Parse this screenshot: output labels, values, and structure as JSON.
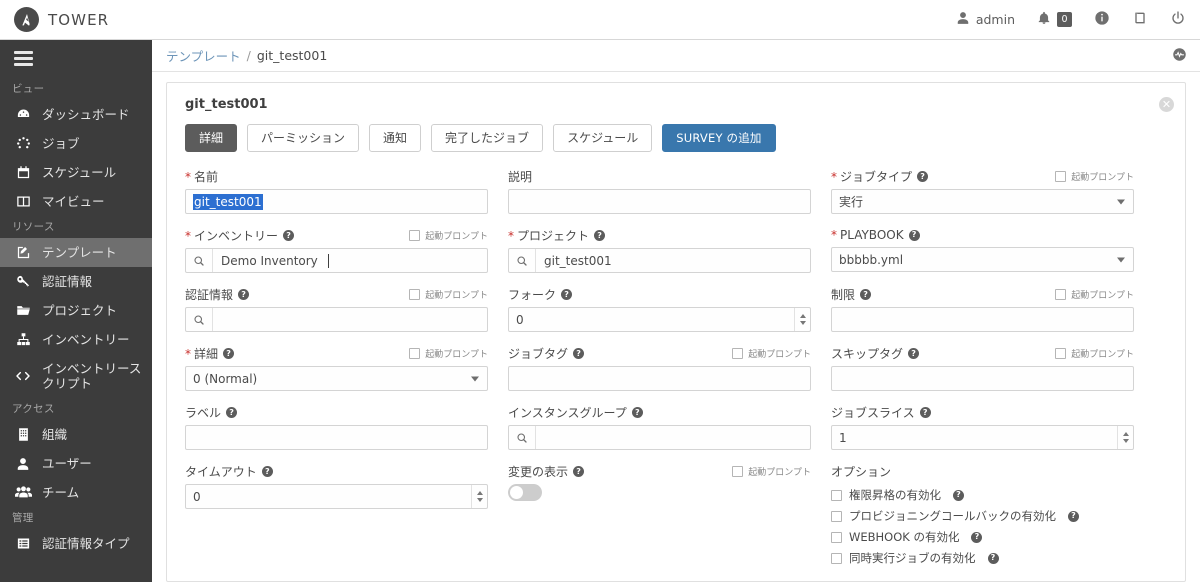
{
  "topbar": {
    "brand": "TOWER",
    "user": "admin",
    "notification_count": "0",
    "icons": [
      "user-icon",
      "bell-icon",
      "info-icon",
      "book-icon",
      "power-icon"
    ]
  },
  "sidebar": {
    "sections": [
      {
        "title": "ビュー",
        "items": [
          {
            "label": "ダッシュボード",
            "icon": "dashboard-icon",
            "active": false
          },
          {
            "label": "ジョブ",
            "icon": "jobs-icon",
            "active": false
          },
          {
            "label": "スケジュール",
            "icon": "calendar-icon",
            "active": false
          },
          {
            "label": "マイビュー",
            "icon": "myview-icon",
            "active": false
          }
        ]
      },
      {
        "title": "リソース",
        "items": [
          {
            "label": "テンプレート",
            "icon": "template-icon",
            "active": true
          },
          {
            "label": "認証情報",
            "icon": "key-icon",
            "active": false
          },
          {
            "label": "プロジェクト",
            "icon": "folder-icon",
            "active": false
          },
          {
            "label": "インベントリー",
            "icon": "inventory-icon",
            "active": false
          },
          {
            "label": "インベントリースクリプト",
            "icon": "code-icon",
            "active": false
          }
        ]
      },
      {
        "title": "アクセス",
        "items": [
          {
            "label": "組織",
            "icon": "building-icon",
            "active": false
          },
          {
            "label": "ユーザー",
            "icon": "user-icon",
            "active": false
          },
          {
            "label": "チーム",
            "icon": "team-icon",
            "active": false
          }
        ]
      },
      {
        "title": "管理",
        "items": [
          {
            "label": "認証情報タイプ",
            "icon": "list-icon",
            "active": false
          }
        ]
      }
    ]
  },
  "breadcrumb": {
    "parent": "テンプレート",
    "separator": "/",
    "current": "git_test001"
  },
  "panel": {
    "title": "git_test001",
    "close_label": "✕",
    "tabs": [
      {
        "label": "詳細",
        "style": "active"
      },
      {
        "label": "パーミッション",
        "style": "normal"
      },
      {
        "label": "通知",
        "style": "normal"
      },
      {
        "label": "完了したジョブ",
        "style": "normal"
      },
      {
        "label": "スケジュール",
        "style": "normal"
      },
      {
        "label": "SURVEY の追加",
        "style": "primary"
      }
    ],
    "prompt_label": "起動プロンプト",
    "fields": {
      "name": {
        "label": "名前",
        "required": true,
        "value": "git_test001",
        "prompt": false,
        "help": false
      },
      "description": {
        "label": "説明",
        "required": false,
        "value": "",
        "prompt": false,
        "help": false
      },
      "job_type": {
        "label": "ジョブタイプ",
        "required": true,
        "value": "実行",
        "prompt": true,
        "help": true
      },
      "inventory": {
        "label": "インベントリー",
        "required": true,
        "value": "Demo Inventory",
        "prompt": true,
        "help": true
      },
      "project": {
        "label": "プロジェクト",
        "required": true,
        "value": "git_test001",
        "prompt": false,
        "help": true
      },
      "playbook": {
        "label": "PLAYBOOK",
        "required": true,
        "value": "bbbbb.yml",
        "prompt": false,
        "help": true
      },
      "credential": {
        "label": "認証情報",
        "required": false,
        "value": "",
        "prompt": true,
        "help": true
      },
      "forks": {
        "label": "フォーク",
        "required": false,
        "value": "0",
        "prompt": false,
        "help": true
      },
      "limit": {
        "label": "制限",
        "required": false,
        "value": "",
        "prompt": true,
        "help": true
      },
      "verbosity": {
        "label": "詳細",
        "required": true,
        "value": "0 (Normal)",
        "prompt": true,
        "help": true
      },
      "job_tags": {
        "label": "ジョブタグ",
        "required": false,
        "value": "",
        "prompt": true,
        "help": true
      },
      "skip_tags": {
        "label": "スキップタグ",
        "required": false,
        "value": "",
        "prompt": true,
        "help": true
      },
      "labels": {
        "label": "ラベル",
        "required": false,
        "value": "",
        "prompt": false,
        "help": true
      },
      "instance_groups": {
        "label": "インスタンスグループ",
        "required": false,
        "value": "",
        "prompt": false,
        "help": true
      },
      "job_slicing": {
        "label": "ジョブスライス",
        "required": false,
        "value": "1",
        "prompt": false,
        "help": true
      },
      "timeout": {
        "label": "タイムアウト",
        "required": false,
        "value": "0",
        "prompt": false,
        "help": true
      },
      "show_changes": {
        "label": "変更の表示",
        "required": false,
        "value": "off",
        "prompt": true,
        "help": true
      }
    },
    "options": {
      "title": "オプション",
      "items": [
        "権限昇格の有効化",
        "プロビジョニングコールバックの有効化",
        "WEBHOOK の有効化",
        "同時実行ジョブの有効化"
      ]
    }
  },
  "colors": {
    "sidebar_bg": "#3c3c3c",
    "sidebar_active": "#6f6f6f",
    "tab_active": "#5c5c5c",
    "primary_button": "#3977ad",
    "required_star": "#c9302c",
    "selection": "#2c6fd1",
    "breadcrumb_link": "#6c94b8"
  }
}
